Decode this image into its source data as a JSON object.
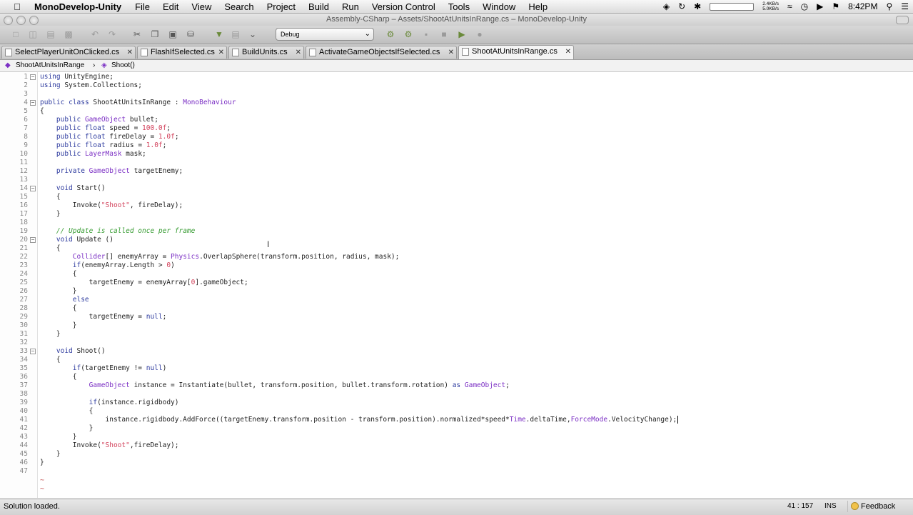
{
  "menubar": {
    "apple": "",
    "app_name": "MonoDevelop-Unity",
    "menus": [
      "File",
      "Edit",
      "View",
      "Search",
      "Project",
      "Build",
      "Run",
      "Version Control",
      "Tools",
      "Window",
      "Help"
    ],
    "net_up": "2.4KB/s",
    "net_down": "5.0KB/s",
    "clock": "8:42PM"
  },
  "window": {
    "title": "Assembly-CSharp – Assets/ShootAtUnitsInRange.cs – MonoDevelop-Unity"
  },
  "toolbar": {
    "configuration": "Debug"
  },
  "tabs": [
    {
      "label": "SelectPlayerUnitOnClicked.cs",
      "active": false
    },
    {
      "label": "FlashIfSelected.cs",
      "active": false
    },
    {
      "label": "BuildUnits.cs",
      "active": false
    },
    {
      "label": "ActivateGameObjectsIfSelected.cs",
      "active": false
    },
    {
      "label": "ShootAtUnitsInRange.cs",
      "active": true
    }
  ],
  "breadcrumb": {
    "class_name": "ShootAtUnitsInRange",
    "member_name": "Shoot()"
  },
  "editor": {
    "lines": [
      {
        "n": "1",
        "fold": true,
        "code": "using UnityEngine;"
      },
      {
        "n": "2",
        "code": "using System.Collections;"
      },
      {
        "n": "3",
        "code": ""
      },
      {
        "n": "4",
        "fold": true,
        "code": "public class ShootAtUnitsInRange : MonoBehaviour"
      },
      {
        "n": "5",
        "code": "{"
      },
      {
        "n": "6",
        "code": "    public GameObject bullet;"
      },
      {
        "n": "7",
        "code": "    public float speed = 100.0f;"
      },
      {
        "n": "8",
        "code": "    public float fireDelay = 1.0f;"
      },
      {
        "n": "9",
        "code": "    public float radius = 1.0f;"
      },
      {
        "n": "10",
        "code": "    public LayerMask mask;"
      },
      {
        "n": "11",
        "code": ""
      },
      {
        "n": "12",
        "code": "    private GameObject targetEnemy;"
      },
      {
        "n": "13",
        "code": ""
      },
      {
        "n": "14",
        "fold": true,
        "code": "    void Start()"
      },
      {
        "n": "15",
        "code": "    {"
      },
      {
        "n": "16",
        "code": "        Invoke(\"Shoot\", fireDelay);"
      },
      {
        "n": "17",
        "code": "    }"
      },
      {
        "n": "18",
        "code": ""
      },
      {
        "n": "19",
        "code": "    // Update is called once per frame"
      },
      {
        "n": "20",
        "fold": true,
        "code": "    void Update ()"
      },
      {
        "n": "21",
        "code": "    {"
      },
      {
        "n": "22",
        "code": "        Collider[] enemyArray = Physics.OverlapSphere(transform.position, radius, mask);"
      },
      {
        "n": "23",
        "code": "        if(enemyArray.Length > 0)"
      },
      {
        "n": "24",
        "code": "        {"
      },
      {
        "n": "25",
        "code": "            targetEnemy = enemyArray[0].gameObject;"
      },
      {
        "n": "26",
        "code": "        }"
      },
      {
        "n": "27",
        "code": "        else"
      },
      {
        "n": "28",
        "code": "        {"
      },
      {
        "n": "29",
        "code": "            targetEnemy = null;"
      },
      {
        "n": "30",
        "code": "        }"
      },
      {
        "n": "31",
        "code": "    }"
      },
      {
        "n": "32",
        "code": ""
      },
      {
        "n": "33",
        "fold": true,
        "code": "    void Shoot()"
      },
      {
        "n": "34",
        "code": "    {"
      },
      {
        "n": "35",
        "code": "        if(targetEnemy != null)"
      },
      {
        "n": "36",
        "code": "        {"
      },
      {
        "n": "37",
        "code": "            GameObject instance = Instantiate(bullet, transform.position, bullet.transform.rotation) as GameObject;"
      },
      {
        "n": "38",
        "code": ""
      },
      {
        "n": "39",
        "code": "            if(instance.rigidbody)"
      },
      {
        "n": "40",
        "code": "            {"
      },
      {
        "n": "41",
        "code": "                instance.rigidbody.AddForce((targetEnemy.transform.position - transform.position).normalized*speed*Time.deltaTime,ForceMode.VelocityChange);"
      },
      {
        "n": "42",
        "code": "            }"
      },
      {
        "n": "43",
        "code": "        }"
      },
      {
        "n": "44",
        "code": "        Invoke(\"Shoot\",fireDelay);"
      },
      {
        "n": "45",
        "code": "    }"
      },
      {
        "n": "46",
        "code": "}"
      },
      {
        "n": "47",
        "code": ""
      }
    ],
    "empty_markers": [
      "~",
      "~"
    ],
    "caret_line": 41
  },
  "statusbar": {
    "message": "Solution loaded.",
    "position": "41 : 157",
    "mode": "INS",
    "feedback": "Feedback"
  },
  "colors": {
    "keyword": "#2e3b9f",
    "type": "#7b2fc4",
    "string": "#d2405a",
    "comment": "#3a9d35"
  }
}
